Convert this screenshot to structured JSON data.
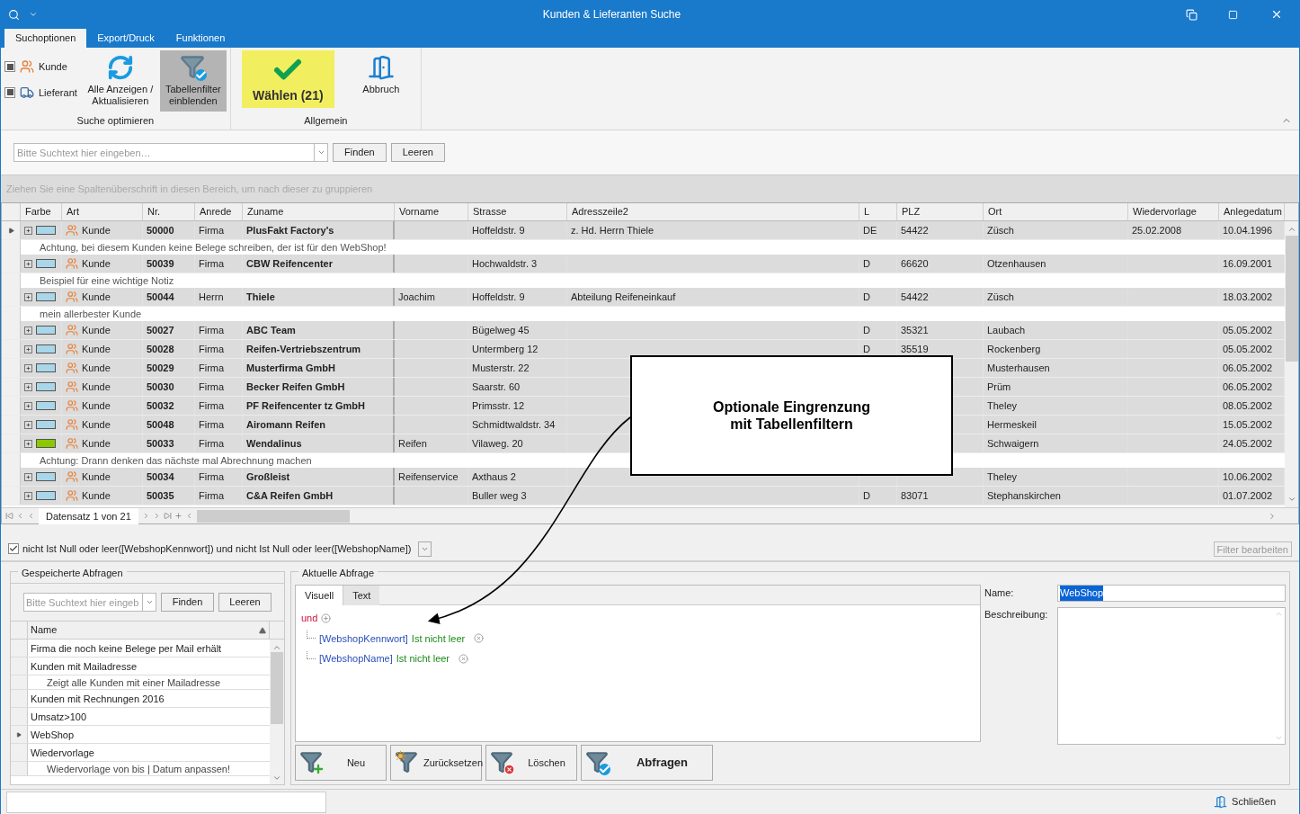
{
  "window": {
    "title": "Kunden & Lieferanten Suche"
  },
  "ribbon_tabs": [
    {
      "label": "Suchoptionen",
      "selected": true
    },
    {
      "label": "Export/Druck",
      "selected": false
    },
    {
      "label": "Funktionen",
      "selected": false
    }
  ],
  "ribbon_groups": [
    {
      "title": "Suche optimieren",
      "checks": [
        {
          "label": "Kunde",
          "kind": "customer",
          "checked": true
        },
        {
          "label": "Lieferant",
          "kind": "supplier",
          "checked": true
        }
      ],
      "buttons": [
        {
          "label": "Alle Anzeigen / Aktualisieren",
          "kind": "refresh",
          "pressed": false,
          "highlighted": false
        },
        {
          "label": "Tabellenfilter einblenden",
          "kind": "filter",
          "pressed": true,
          "highlighted": false
        }
      ]
    },
    {
      "title": "Allgemein",
      "buttons": [
        {
          "label": "Wählen (21)",
          "kind": "check",
          "pressed": false,
          "highlighted": true
        },
        {
          "label": "Abbruch",
          "kind": "exit",
          "pressed": false,
          "highlighted": false
        }
      ]
    }
  ],
  "search": {
    "placeholder": "Bitte Suchtext hier eingeben…",
    "buttons": [
      "Finden",
      "Leeren"
    ]
  },
  "group_hint": "Ziehen Sie eine Spaltenüberschrift in diesen Bereich, um nach dieser zu gruppieren",
  "table": {
    "columns": [
      "Farbe",
      "Art",
      "Nr.",
      "Anrede",
      "Zuname",
      "Vorname",
      "Strasse",
      "Adresszeile2",
      "L",
      "PLZ",
      "Ort",
      "Wiedervorlage",
      "Anlegedatum"
    ],
    "rows": [
      {
        "selected": true,
        "color": "#a9d6e8",
        "art": "Kunde",
        "nr": "50000",
        "anrede": "Firma",
        "zuname": "PlusFakt Factory's",
        "strasse": "Hoffeldstr. 9",
        "adresse2": "z. Hd. Herrn Thiele",
        "l": "DE",
        "plz": "54422",
        "ort": "Züsch",
        "wiedervorlage": "25.02.2008",
        "anlegedatum": "10.04.1996",
        "note": "Achtung, bei diesem Kunden keine Belege schreiben, der ist für den WebShop!"
      },
      {
        "selected": false,
        "color": "#a9d6e8",
        "art": "Kunde",
        "nr": "50039",
        "anrede": "Firma",
        "zuname": "CBW Reifencenter",
        "strasse": "Hochwaldstr. 3",
        "l": "D",
        "plz": "66620",
        "ort": "Otzenhausen",
        "anlegedatum": "16.09.2001",
        "note": "Beispiel für eine wichtige Notiz"
      },
      {
        "selected": false,
        "color": "#a9d6e8",
        "art": "Kunde",
        "nr": "50044",
        "anrede": "Herrn",
        "zuname": "Thiele",
        "vorname": "Joachim",
        "strasse": "Hoffeldstr. 9",
        "adresse2": "Abteilung Reifeneinkauf",
        "l": "D",
        "plz": "54422",
        "ort": "Züsch",
        "anlegedatum": "18.03.2002",
        "note": "mein allerbester Kunde"
      },
      {
        "selected": false,
        "color": "#a9d6e8",
        "art": "Kunde",
        "nr": "50027",
        "anrede": "Firma",
        "zuname": "ABC Team",
        "strasse": "Bügelweg 45",
        "l": "D",
        "plz": "35321",
        "ort": "Laubach",
        "anlegedatum": "05.05.2002"
      },
      {
        "selected": false,
        "color": "#a9d6e8",
        "art": "Kunde",
        "nr": "50028",
        "anrede": "Firma",
        "zuname": "Reifen-Vertriebszentrum",
        "strasse": "Untermberg 12",
        "l": "D",
        "plz": "35519",
        "ort": "Rockenberg",
        "anlegedatum": "05.05.2002"
      },
      {
        "selected": false,
        "color": "#a9d6e8",
        "art": "Kunde",
        "nr": "50029",
        "anrede": "Firma",
        "zuname": "Musterfirma GmbH",
        "strasse": "Musterstr. 22",
        "ort": "Musterhausen",
        "anlegedatum": "06.05.2002"
      },
      {
        "selected": false,
        "color": "#a9d6e8",
        "art": "Kunde",
        "nr": "50030",
        "anrede": "Firma",
        "zuname": "Becker Reifen GmbH",
        "strasse": "Saarstr. 60",
        "ort": "Prüm",
        "anlegedatum": "06.05.2002"
      },
      {
        "selected": false,
        "color": "#a9d6e8",
        "art": "Kunde",
        "nr": "50032",
        "anrede": "Firma",
        "zuname": "PF Reifencenter tz GmbH",
        "strasse": "Primsstr. 12",
        "ort": "Theley",
        "anlegedatum": "08.05.2002"
      },
      {
        "selected": false,
        "color": "#a9d6e8",
        "art": "Kunde",
        "nr": "50048",
        "anrede": "Firma",
        "zuname": "Airomann Reifen",
        "strasse": "Schmidtwaldstr. 34",
        "ort": "Hermeskeil",
        "anlegedatum": "15.05.2002"
      },
      {
        "selected": false,
        "color": "#8cc800",
        "art": "Kunde",
        "nr": "50033",
        "anrede": "Firma",
        "zuname": "Wendalinus",
        "vorname": "Reifen",
        "strasse": "Vilaweg. 20",
        "ort": "Schwaigern",
        "anlegedatum": "24.05.2002",
        "note": "Achtung: Drann denken das nächste mal Abrechnung machen"
      },
      {
        "selected": false,
        "color": "#a9d6e8",
        "art": "Kunde",
        "nr": "50034",
        "anrede": "Firma",
        "zuname": "Großleist",
        "vorname": "Reifenservice",
        "strasse": "Axthaus 2",
        "ort": "Theley",
        "anlegedatum": "10.06.2002"
      },
      {
        "selected": false,
        "color": "#a9d6e8",
        "art": "Kunde",
        "nr": "50035",
        "anrede": "Firma",
        "zuname": "C&A Reifen GmbH",
        "strasse": "Buller weg 3",
        "l": "D",
        "plz": "83071",
        "ort": "Stephanskirchen",
        "anlegedatum": "01.07.2002"
      }
    ]
  },
  "navigator": {
    "label": "Datensatz 1 von 21"
  },
  "callout": {
    "text": "Optionale Eingrenzung mit Tabellenfiltern"
  },
  "filter_bar": {
    "checked": true,
    "expression": "nicht Ist Null oder leer([WebshopKennwort]) und nicht Ist Null oder leer([WebshopName])",
    "edit_button": "Filter bearbeiten"
  },
  "saved_queries": {
    "title": "Gespeicherte Abfragen",
    "placeholder": "Bitte Suchtext hier eingeb",
    "buttons": [
      "Finden",
      "Leeren"
    ],
    "column": "Name",
    "items": [
      {
        "name": "Firma die noch keine Belege per Mail erhält",
        "selected": false
      },
      {
        "name": "Kunden mit Mailadresse",
        "description": "Zeigt alle Kunden mit einer Mailadresse",
        "selected": false
      },
      {
        "name": "Kunden mit Rechnungen 2016",
        "selected": false
      },
      {
        "name": "Umsatz>100",
        "selected": false
      },
      {
        "name": "WebShop",
        "selected": true
      },
      {
        "name": "Wiedervorlage",
        "description": "Wiedervorlage von bis | Datum anpassen!",
        "selected": false
      }
    ]
  },
  "current_query": {
    "title": "Aktuelle Abfrage",
    "tabs": [
      {
        "label": "Visuell",
        "selected": true
      },
      {
        "label": "Text",
        "selected": false
      }
    ],
    "tree": {
      "operator": "und",
      "children": [
        {
          "field": "[WebshopKennwort]",
          "condition": "Ist nicht leer"
        },
        {
          "field": "[WebshopName]",
          "condition": "Ist nicht leer"
        }
      ]
    },
    "name_label": "Name:",
    "name_value": "WebShop",
    "name_text_selected": true,
    "description_label": "Beschreibung:",
    "buttons": [
      {
        "label": "Neu",
        "kind": "new",
        "primary": false
      },
      {
        "label": "Zurücksetzen",
        "kind": "reset",
        "primary": false
      },
      {
        "label": "Löschen",
        "kind": "delete",
        "primary": false
      },
      {
        "label": "Abfragen",
        "kind": "run",
        "primary": true
      }
    ]
  },
  "status_bar": {
    "close_button": "Schließen"
  }
}
